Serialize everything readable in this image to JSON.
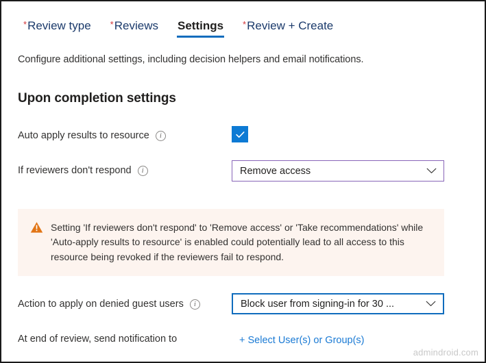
{
  "tabs": [
    {
      "required_marker": "*",
      "label": "Review type",
      "active": false
    },
    {
      "required_marker": "*",
      "label": "Reviews",
      "active": false
    },
    {
      "required_marker": "",
      "label": "Settings",
      "active": true
    },
    {
      "required_marker": "*",
      "label": "Review + Create",
      "active": false
    }
  ],
  "page": {
    "subtitle": "Configure additional settings, including decision helpers and email notifications.",
    "section_heading": "Upon completion settings"
  },
  "fields": {
    "auto_apply": {
      "label": "Auto apply results to resource",
      "info_glyph": "i",
      "checked": true
    },
    "no_respond": {
      "label": "If reviewers don't respond",
      "info_glyph": "i",
      "value": "Remove access",
      "chevron_glyph": "chevron-down"
    },
    "denied_guest": {
      "label": "Action to apply on denied guest users",
      "info_glyph": "i",
      "value": "Block user from signing-in for 30 ...",
      "chevron_glyph": "chevron-down"
    },
    "notification": {
      "label": "At end of review, send notification to",
      "link_label": "+ Select User(s) or Group(s)"
    }
  },
  "warning": {
    "icon": "warning-triangle",
    "text": "Setting 'If reviewers don't respond' to 'Remove access' or 'Take recommendations' while 'Auto-apply results to resource' is enabled could potentially lead to all access to this resource being revoked if the reviewers fail to respond."
  },
  "watermark": "admindroid.com",
  "colors": {
    "accent_blue": "#0f6cbd",
    "checkbox_blue": "#0d7ad4",
    "dropdown_purple": "#8764b8",
    "warning_orange": "#e27516",
    "warning_bg": "#fdf4ef",
    "required_red": "#d13438",
    "link_blue": "#1a7ad4"
  }
}
